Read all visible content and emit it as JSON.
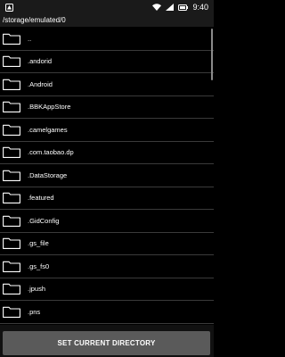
{
  "status_bar": {
    "time": "9:40"
  },
  "path": "/storage/emulated/0",
  "files": [
    {
      "name": ".."
    },
    {
      "name": ".andorid"
    },
    {
      "name": ".Android"
    },
    {
      "name": ".BBKAppStore"
    },
    {
      "name": ".camelgames"
    },
    {
      "name": ".com.taobao.dp"
    },
    {
      "name": ".DataStorage"
    },
    {
      "name": ".featured"
    },
    {
      "name": ".GidConfig"
    },
    {
      "name": ".gs_file"
    },
    {
      "name": ".gs_fs0"
    },
    {
      "name": ".jpush"
    },
    {
      "name": ".pns"
    }
  ],
  "action_button": {
    "label": "SET CURRENT DIRECTORY"
  },
  "colors": {
    "background": "#000000",
    "button": "#5a5a5a",
    "divider": "#3a3a3a"
  }
}
